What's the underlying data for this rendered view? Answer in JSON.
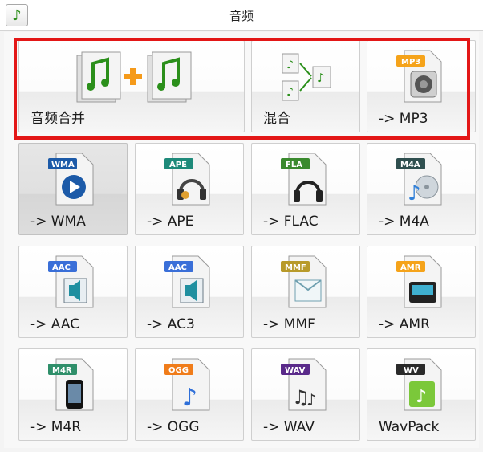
{
  "window": {
    "title": "音频",
    "icon": "music-note-icon"
  },
  "tiles_top": [
    {
      "label": "音频合并",
      "icon": "audio-merge-icon"
    },
    {
      "label": "混合",
      "icon": "audio-mix-icon"
    },
    {
      "label": "-> MP3",
      "icon": "mp3-file-icon",
      "badge": "MP3",
      "badge_color": "#f5a31a"
    }
  ],
  "tiles": [
    {
      "label": "-> WMA",
      "icon": "wma-file-icon",
      "badge": "WMA",
      "badge_color": "#1c5aa8"
    },
    {
      "label": "-> APE",
      "icon": "ape-file-icon",
      "badge": "APE",
      "badge_color": "#1e8a7a"
    },
    {
      "label": "-> FLAC",
      "icon": "flac-file-icon",
      "badge": "FLA",
      "badge_color": "#3a8a2e"
    },
    {
      "label": "-> M4A",
      "icon": "m4a-file-icon",
      "badge": "M4A",
      "badge_color": "#2f4f4f"
    },
    {
      "label": "-> AAC",
      "icon": "aac-file-icon",
      "badge": "AAC",
      "badge_color": "#3a6fd8"
    },
    {
      "label": "-> AC3",
      "icon": "ac3-file-icon",
      "badge": "AAC",
      "badge_color": "#3a6fd8"
    },
    {
      "label": "-> MMF",
      "icon": "mmf-file-icon",
      "badge": "MMF",
      "badge_color": "#b89a2a"
    },
    {
      "label": "-> AMR",
      "icon": "amr-file-icon",
      "badge": "AMR",
      "badge_color": "#f5a31a"
    },
    {
      "label": "-> M4R",
      "icon": "m4r-file-icon",
      "badge": "M4R",
      "badge_color": "#2f8f6a"
    },
    {
      "label": "-> OGG",
      "icon": "ogg-file-icon",
      "badge": "OGG",
      "badge_color": "#f07c1a"
    },
    {
      "label": "-> WAV",
      "icon": "wav-file-icon",
      "badge": "WAV",
      "badge_color": "#5a2a8a"
    },
    {
      "label": "WavPack",
      "icon": "wavpack-file-icon",
      "badge": "WV",
      "badge_color": "#2a2a2a"
    }
  ],
  "selected_tile": "-> WMA",
  "highlight_color": "#e31717"
}
